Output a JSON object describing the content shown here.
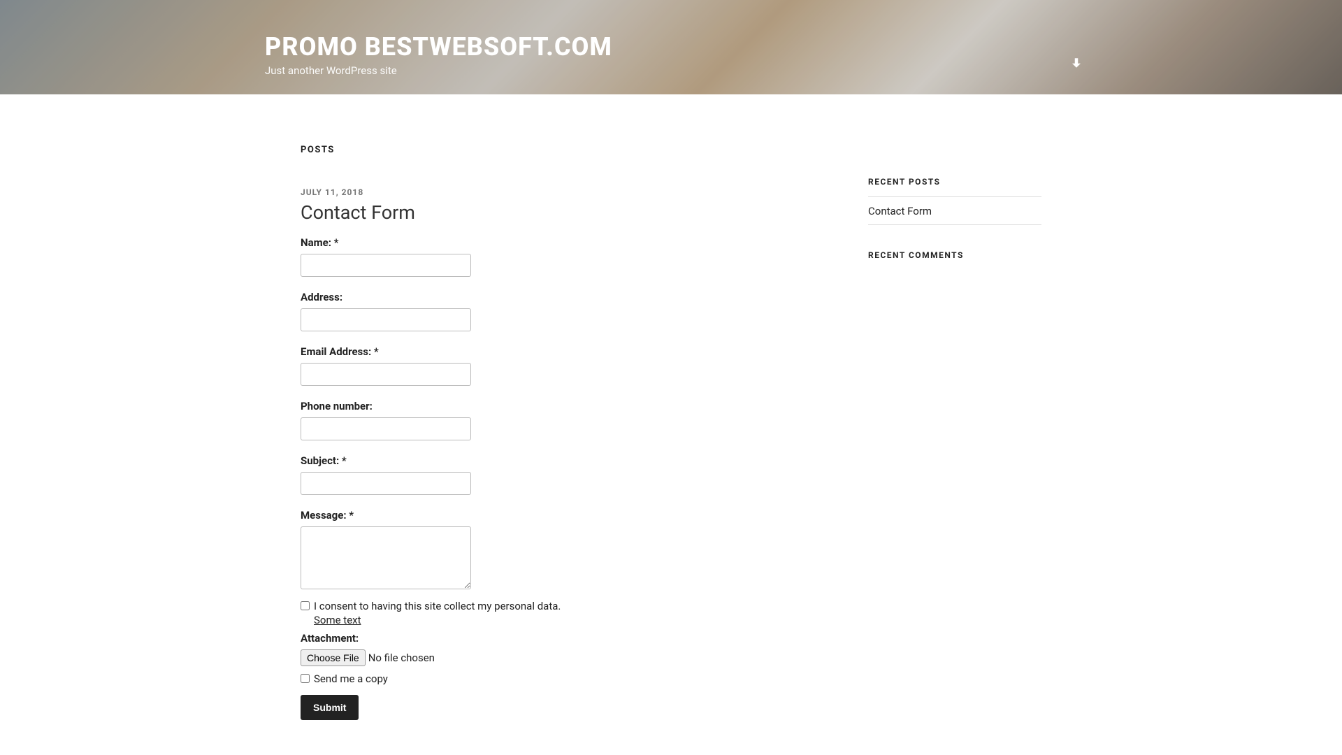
{
  "hero": {
    "title": "PROMO BESTWEBSOFT.COM",
    "tagline": "Just another WordPress site"
  },
  "content": {
    "posts_heading": "POSTS",
    "post_date": "JULY 11, 2018",
    "post_title": "Contact Form"
  },
  "form": {
    "name_label": "Name: *",
    "address_label": "Address:",
    "email_label": "Email Address: *",
    "phone_label": "Phone number:",
    "subject_label": "Subject: *",
    "message_label": "Message: *",
    "consent_text": "I consent to having this site collect my personal data. ",
    "consent_link": "Some text",
    "attachment_label": "Attachment:",
    "choose_file_label": "Choose File",
    "no_file_chosen": "No file chosen",
    "send_copy_label": "Send me a copy",
    "submit_label": "Submit",
    "values": {
      "name": "",
      "address": "",
      "email": "",
      "phone": "",
      "subject": "",
      "message": ""
    }
  },
  "sidebar": {
    "recent_posts_title": "RECENT POSTS",
    "recent_posts": [
      {
        "label": "Contact Form"
      }
    ],
    "recent_comments_title": "RECENT COMMENTS"
  }
}
